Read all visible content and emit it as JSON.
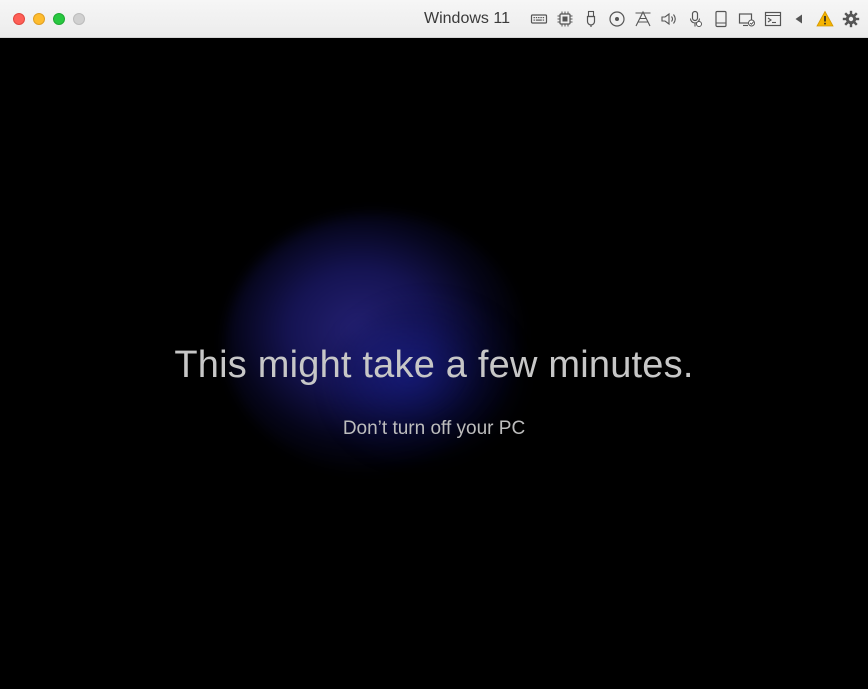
{
  "window": {
    "title": "Windows 11",
    "controls": [
      "close",
      "minimize",
      "zoom",
      "fullscreen"
    ]
  },
  "toolbar": {
    "icons": [
      "keyboard-icon",
      "cpu-icon",
      "usb-icon",
      "cd-dvd-icon",
      "network-icon",
      "sound-icon",
      "microphone-icon",
      "hard-disk-icon",
      "shared-folders-icon",
      "console-icon",
      "collapse-arrow-icon",
      "warning-icon",
      "settings-gear-icon"
    ],
    "warning_color": "#f5b400"
  },
  "screen": {
    "headline": "This might take a few minutes.",
    "subtext": "Don’t turn off your PC",
    "background_color": "#000000",
    "glow_color": "#262278"
  }
}
